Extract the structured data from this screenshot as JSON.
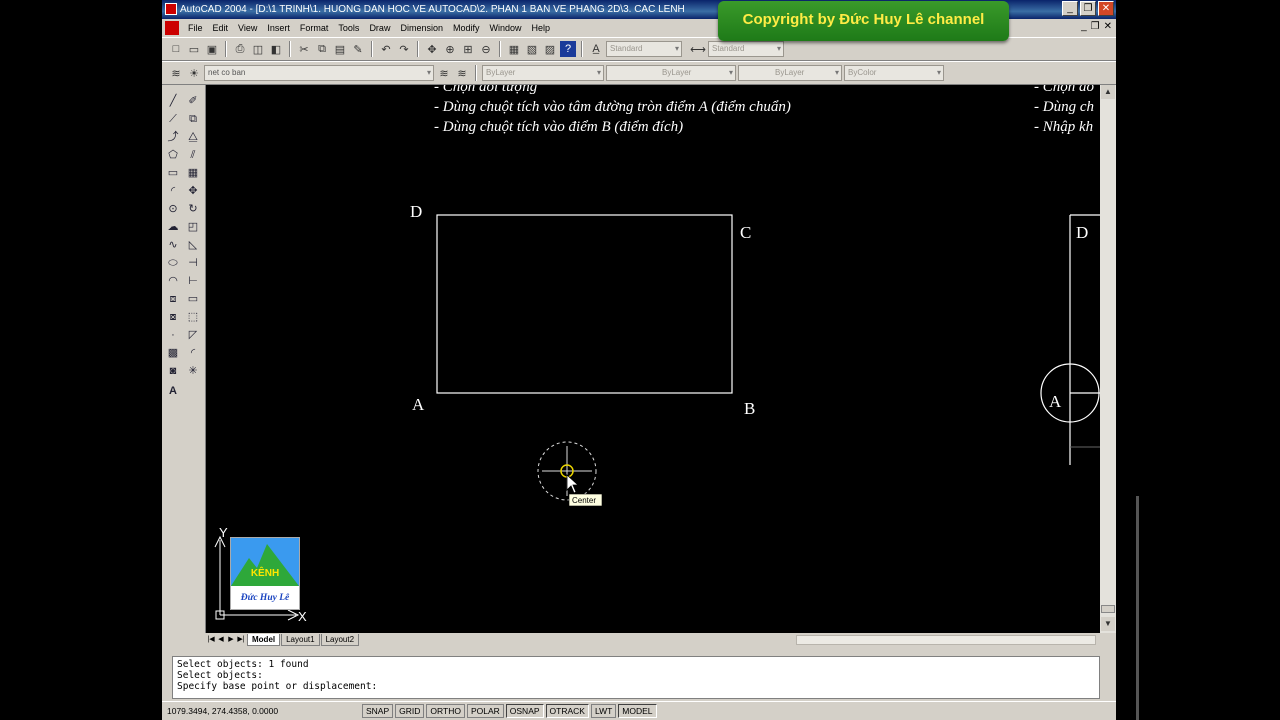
{
  "window": {
    "title": "AutoCAD 2004 - [D:\\1 TRINH\\1. HUONG DAN HOC VE AUTOCAD\\2. PHAN 1 BAN VE PHANG 2D\\3. CAC LENH",
    "buttons": {
      "minimize": "_",
      "restore": "❐",
      "close": "✕"
    }
  },
  "menubar": {
    "items": [
      "File",
      "Edit",
      "View",
      "Insert",
      "Format",
      "Tools",
      "Draw",
      "Dimension",
      "Modify",
      "Window",
      "Help"
    ],
    "mdi_buttons": [
      "_",
      "❐",
      "✕"
    ]
  },
  "toolbar1": {
    "text_style": "Standard",
    "dim_style": "Standard"
  },
  "toolbar2": {
    "layer": "net co ban",
    "color": "ByLayer",
    "linetype": "ByLayer",
    "lineweight": "ByLayer",
    "plotstyle": "ByColor"
  },
  "canvas": {
    "instructions_left": [
      "- Chọn đối tượng",
      "- Dùng chuột tích vào tâm đường tròn điểm A (điểm chuẩn)",
      "- Dùng chuột tích vào điểm B (điểm đích)"
    ],
    "instructions_right": [
      "- Chọn đố",
      "- Dùng ch",
      "- Nhập kh"
    ],
    "labels": {
      "D": "D",
      "C": "C",
      "A": "A",
      "B": "B",
      "D2": "D",
      "A2": "A"
    },
    "snap_tooltip": "Center",
    "ucs": {
      "x": "X",
      "y": "Y"
    }
  },
  "logo": {
    "line1": "KÊNH",
    "line2": "Đức Huy Lê"
  },
  "tabs": [
    "Model",
    "Layout1",
    "Layout2"
  ],
  "command_lines": [
    "Select objects: 1 found",
    "Select objects:",
    "Specify base point or displacement:"
  ],
  "status": {
    "coords": "1079.3494, 274.4358, 0.0000",
    "toggles": [
      "SNAP",
      "GRID",
      "ORTHO",
      "POLAR",
      "OSNAP",
      "OTRACK",
      "LWT",
      "MODEL"
    ]
  },
  "copyright": "Copyright by Đức Huy Lê channel"
}
